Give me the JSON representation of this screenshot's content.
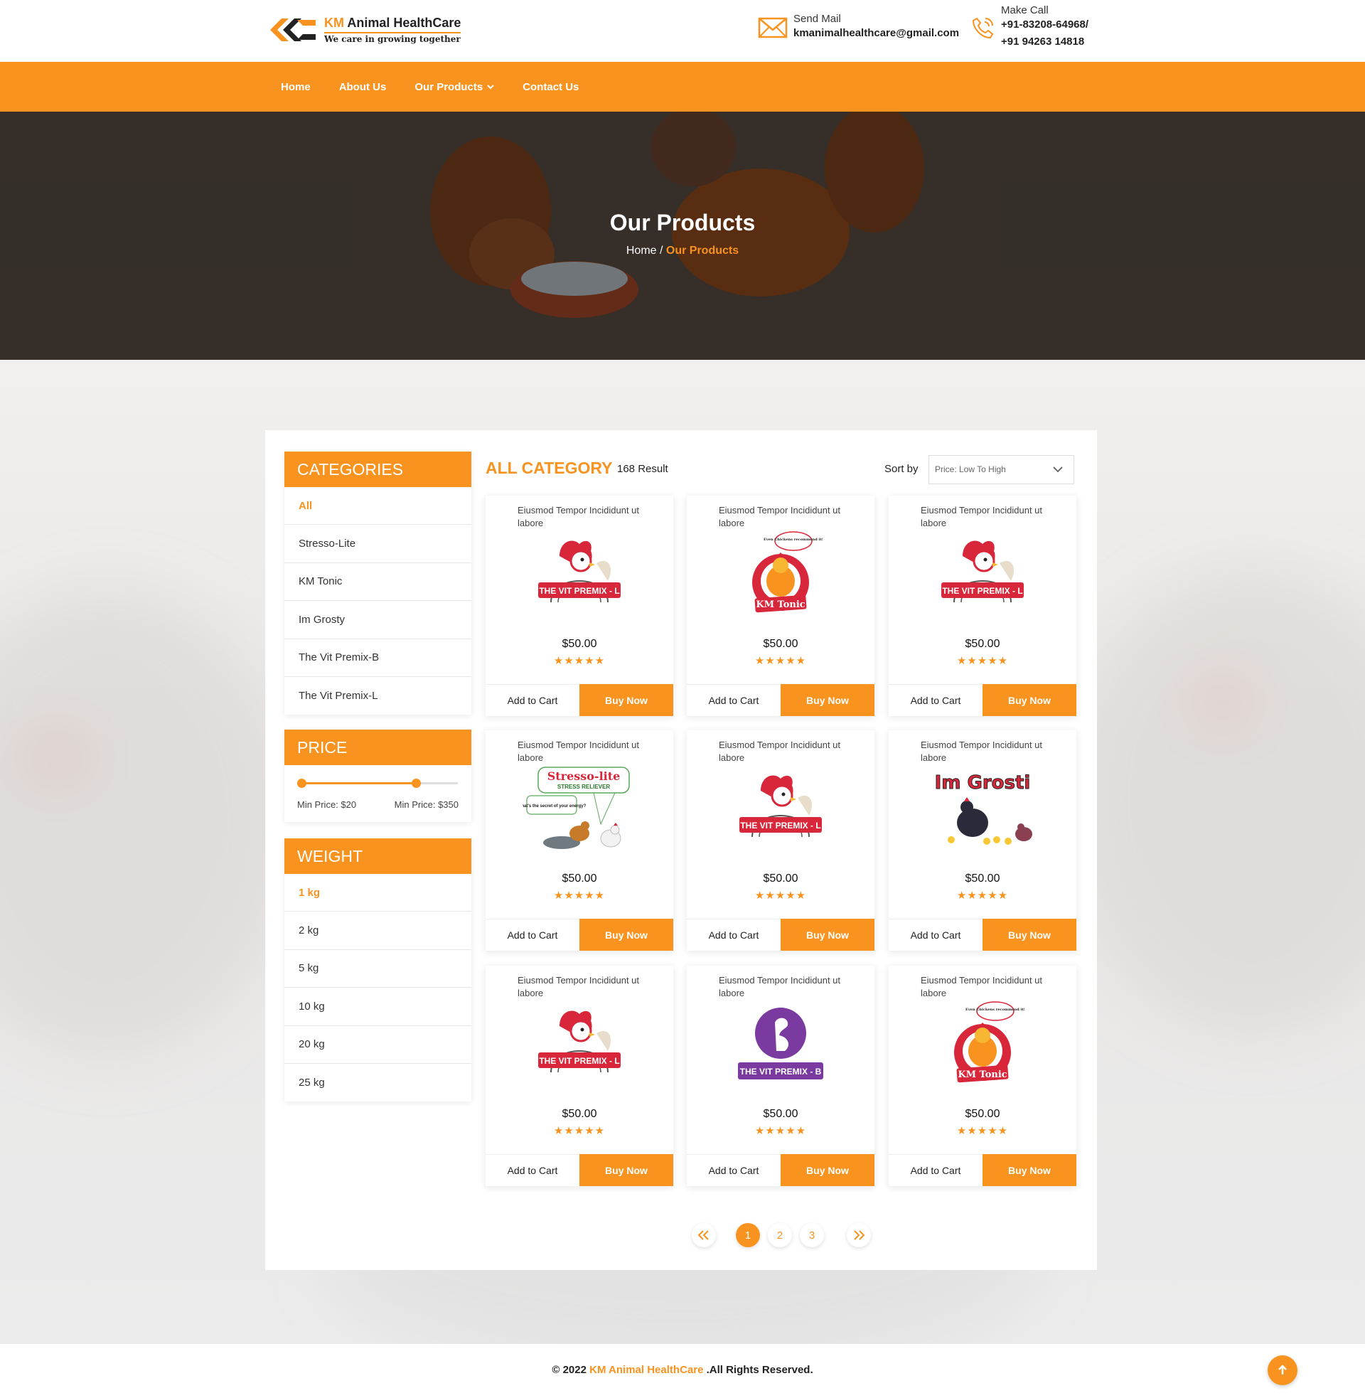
{
  "brand": {
    "name_accent": "KM",
    "name_rest": " Animal HealthCare",
    "tagline": "We care in growing together"
  },
  "contact": {
    "mail_label": "Send Mail",
    "mail_value": "kmanimalhealthcare@gmail.com",
    "call_label": "Make Call",
    "call_value_1": "+91-83208-64968/",
    "call_value_2": "+91 94263 14818"
  },
  "nav": {
    "home": "Home",
    "about": "About Us",
    "products": "Our Products",
    "contact": "Contact Us"
  },
  "hero": {
    "title": "Our Products",
    "crumb_home": "Home",
    "crumb_sep": " / ",
    "crumb_current": "Our Products"
  },
  "sidebar": {
    "categories_title": "CATEGORIES",
    "categories": [
      "All",
      "Stresso-Lite",
      "KM Tonic",
      "Im Grosty",
      "The Vit Premix-B",
      "The Vit Premix-L"
    ],
    "price_title": "PRICE",
    "price_min_label": "Min Price: $20",
    "price_max_label": "Min Price: $350",
    "price_range_fraction": [
      0.0,
      0.73
    ],
    "weight_title": "WEIGHT",
    "weights": [
      "1 kg",
      "2 kg",
      "5 kg",
      "10 kg",
      "20 kg",
      "25 kg"
    ]
  },
  "listing": {
    "heading": "ALL CATEGORY",
    "result": "168 Result",
    "sort_label": "Sort by",
    "sort_value": "Price: Low To High",
    "add_to_cart": "Add to Cart",
    "buy_now": "Buy Now"
  },
  "products": [
    {
      "title": "Eiusmod Tempor Incididunt ut labore",
      "price": "$50.00",
      "stars": "★★★★★",
      "image": "vit-premix-l"
    },
    {
      "title": "Eiusmod Tempor Incididunt ut labore",
      "price": "$50.00",
      "stars": "★★★★★",
      "image": "km-tonic"
    },
    {
      "title": "Eiusmod Tempor Incididunt ut labore",
      "price": "$50.00",
      "stars": "★★★★★",
      "image": "vit-premix-l"
    },
    {
      "title": "Eiusmod Tempor Incididunt ut labore",
      "price": "$50.00",
      "stars": "★★★★★",
      "image": "stresso-lite"
    },
    {
      "title": "Eiusmod Tempor Incididunt ut labore",
      "price": "$50.00",
      "stars": "★★★★★",
      "image": "vit-premix-l"
    },
    {
      "title": "Eiusmod Tempor Incididunt ut labore",
      "price": "$50.00",
      "stars": "★★★★★",
      "image": "im-grosti"
    },
    {
      "title": "Eiusmod Tempor Incididunt ut labore",
      "price": "$50.00",
      "stars": "★★★★★",
      "image": "vit-premix-l"
    },
    {
      "title": "Eiusmod Tempor Incididunt ut labore",
      "price": "$50.00",
      "stars": "★★★★★",
      "image": "vit-premix-b"
    },
    {
      "title": "Eiusmod Tempor Incididunt ut labore",
      "price": "$50.00",
      "stars": "★★★★★",
      "image": "km-tonic"
    }
  ],
  "product_labels": {
    "vit_l": "THE VIT PREMIX - L",
    "vit_b": "THE VIT PREMIX - B",
    "tonic": "KM Tonic",
    "stresso": "Stresso-lite",
    "stresso_sub": "STRESS RELIEVER",
    "stresso_q": "What's the secret of your energy?",
    "grosti": "Im Grosti",
    "tonic_bubble": "Even Chickens recommend it!"
  },
  "pagination": {
    "prev": "«",
    "pages": [
      "1",
      "2",
      "3"
    ],
    "next": "»",
    "current": "1"
  },
  "footer": {
    "copy": "© 2022 ",
    "brand": "KM Animal HealthCare",
    "rest": " .All Rights Reserved."
  },
  "colors": {
    "accent": "#f7931e",
    "dark": "#222222"
  }
}
